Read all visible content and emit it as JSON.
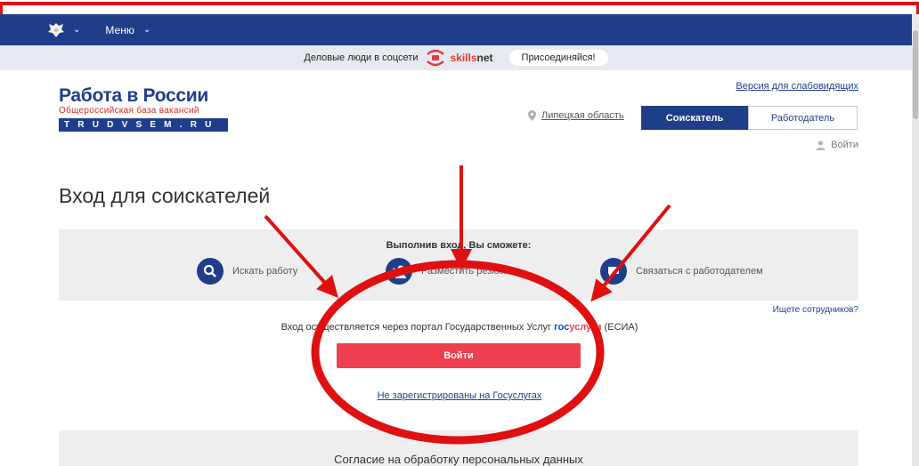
{
  "navbar": {
    "menu_label": "Меню"
  },
  "promo": {
    "text": "Деловые люди в соцсети",
    "brand_part1": "skills",
    "brand_part2": "net",
    "join_label": "Присоединяйся!"
  },
  "logo": {
    "title": "Работа в России",
    "subtitle": "Общероссийская база вакансий",
    "domain": "TRUDVSEM.RU"
  },
  "header": {
    "accessibility_link": "Версия для слабовидящих",
    "region": "Липецкая область",
    "role_seeker": "Соискатель",
    "role_employer": "Работодатель",
    "login_label": "Войти"
  },
  "page": {
    "title": "Вход для соискателей"
  },
  "benefits": {
    "title": "Выполнив вход, Вы сможете:",
    "items": [
      {
        "label": "Искать работу",
        "icon": "search-icon"
      },
      {
        "label": "Разместить резюме",
        "icon": "add-user-icon"
      },
      {
        "label": "Связаться с работодателем",
        "icon": "chat-icon"
      }
    ]
  },
  "employers_link": "Ищете сотрудников?",
  "esia": {
    "prefix": "Вход осуществляется через портал Государственных Услуг",
    "gos_part1": "гос",
    "gos_part2": "услуги",
    "suffix": "(ЕСИА)"
  },
  "login_button": "Войти",
  "not_registered": "Не зарегистрированы на Госуслугах",
  "consent": {
    "title": "Согласие на обработку персональных данных"
  },
  "colors": {
    "primary": "#1f3e8a",
    "accent_red": "#ee3f4f",
    "annotation_red": "#e01010",
    "panel_gray": "#eeeeee"
  }
}
